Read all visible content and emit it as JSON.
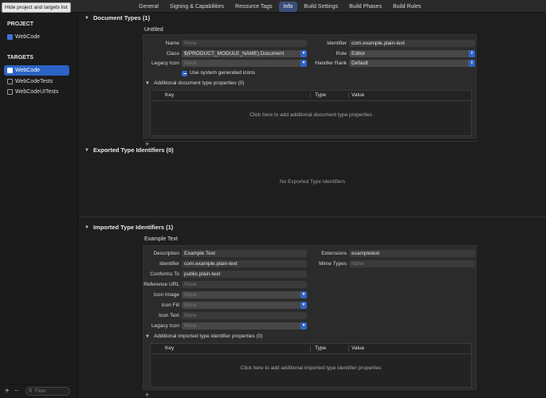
{
  "tooltip": "Hide project and targets list",
  "tabs": [
    {
      "label": "General"
    },
    {
      "label": "Signing & Capabilities"
    },
    {
      "label": "Resource Tags"
    },
    {
      "label": "Info"
    },
    {
      "label": "Build Settings"
    },
    {
      "label": "Build Phases"
    },
    {
      "label": "Build Rules"
    }
  ],
  "active_tab": "Info",
  "sidebar": {
    "project_header": "PROJECT",
    "project_item": "WebCode",
    "targets_header": "TARGETS",
    "targets": [
      {
        "label": "WebCode",
        "icon": "app-icon",
        "selected": true
      },
      {
        "label": "WebCodeTests",
        "icon": "test-target-icon",
        "selected": false
      },
      {
        "label": "WebCodeUITests",
        "icon": "test-target-icon",
        "selected": false
      }
    ],
    "filter_placeholder": "Filter",
    "add_label": "+",
    "remove_label": "−"
  },
  "document_types": {
    "title": "Document Types (1)",
    "subtitle": "Untitled",
    "name_label": "Name",
    "name_placeholder": "None",
    "class_label": "Class",
    "class_value": "$(PRODUCT_MODULE_NAME).Document",
    "legacy_icon_label": "Legacy Icon",
    "legacy_icon_value": "None",
    "use_system_icons": "Use system generated icons",
    "identifier_label": "Identifier",
    "identifier_value": "com.example.plain-text",
    "role_label": "Role",
    "role_value": "Editor",
    "handler_rank_label": "Handler Rank",
    "handler_rank_value": "Default",
    "additional_props": "Additional document type properties (0)",
    "table_headers": [
      "Key",
      "Type",
      "Value"
    ],
    "table_empty": "Click here to add additional document type properties",
    "add": "+"
  },
  "exported_types": {
    "title": "Exported Type Identifiers (0)",
    "empty": "No Exported Type Identifiers"
  },
  "imported_types": {
    "title": "Imported Type Identifiers (1)",
    "subtitle": "Example Text",
    "description_label": "Description",
    "description_value": "Example Text",
    "identifier_label": "Identifier",
    "identifier_value": "com.example.plain-text",
    "conforms_label": "Conforms To",
    "conforms_value": "public.plain-text",
    "reference_url_label": "Reference URL",
    "reference_url_placeholder": "None",
    "icon_image_label": "Icon Image",
    "icon_image_value": "None",
    "icon_fill_label": "Icon Fill",
    "icon_fill_value": "None",
    "icon_text_label": "Icon Text",
    "icon_text_placeholder": "None",
    "legacy_icon_label": "Legacy Icon",
    "legacy_icon_value": "None",
    "extensions_label": "Extensions",
    "extensions_value": "exampletext",
    "mime_label": "Mime Types",
    "mime_placeholder": "None",
    "additional_props": "Additional imported type identifier properties (0)",
    "table_headers": [
      "Key",
      "Type",
      "Value"
    ],
    "table_empty": "Click here to add additional imported type identifier properties",
    "add": "+"
  },
  "colors": {
    "accent": "#2f64c8",
    "selection": "#2a63c5",
    "background": "#1e1e1e"
  }
}
